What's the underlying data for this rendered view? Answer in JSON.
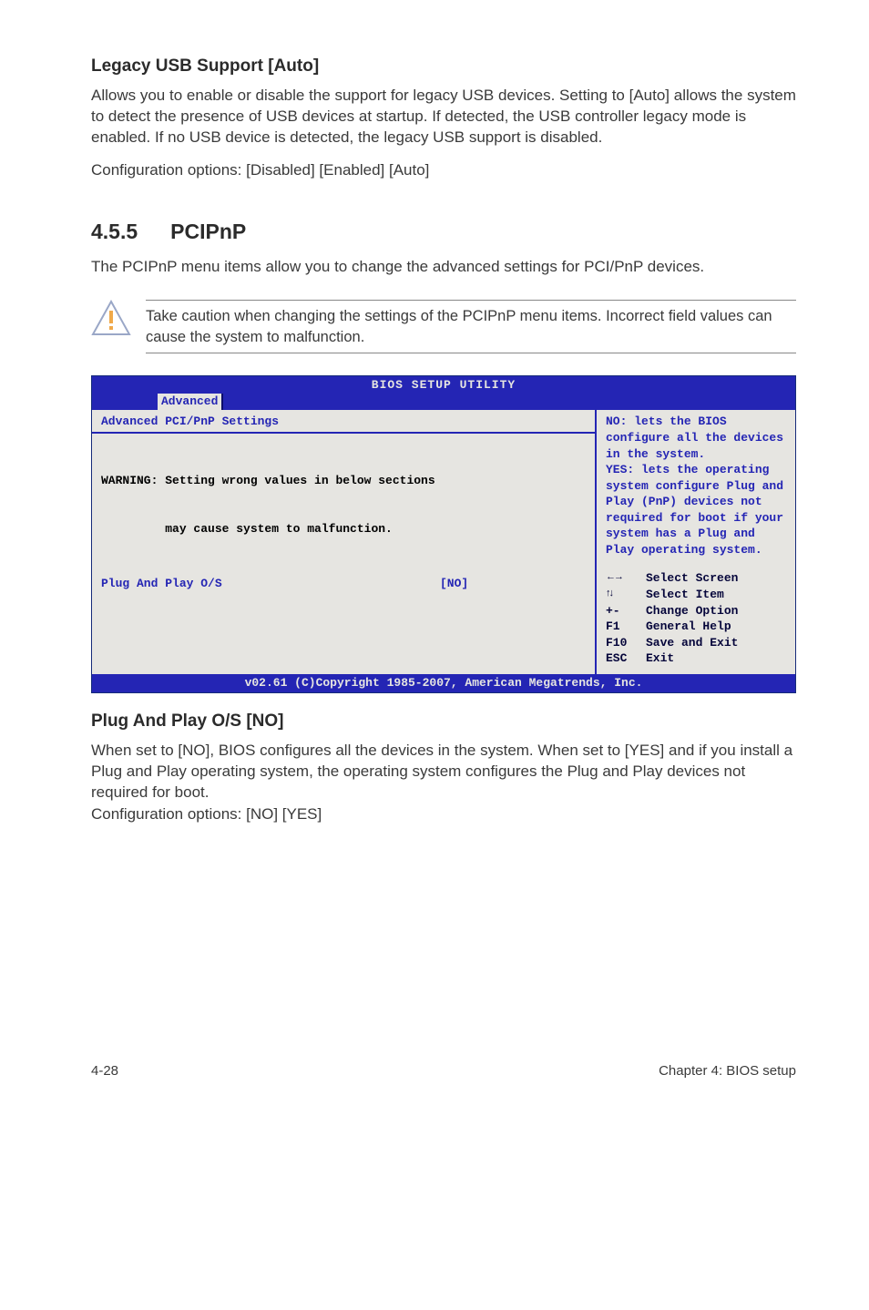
{
  "s1": {
    "heading": "Legacy USB Support [Auto]",
    "para": "Allows you to enable or disable the support for legacy USB devices. Setting to [Auto] allows the system to detect the presence of USB devices at startup. If detected, the USB controller legacy mode is enabled. If no USB device is detected, the legacy USB support is disabled.",
    "cfg": "Configuration options: [Disabled] [Enabled] [Auto]"
  },
  "sec": {
    "num": "4.5.5",
    "title": "PCIPnP",
    "intro": "The PCIPnP menu items allow you to change the advanced settings for PCI/PnP devices.",
    "note": "Take caution when changing the settings of the PCIPnP menu items. Incorrect field values can cause the system to malfunction."
  },
  "bios": {
    "title": "BIOS SETUP UTILITY",
    "tab": "Advanced",
    "panel_title": "Advanced PCI/PnP Settings",
    "warn1": "WARNING: Setting wrong values in below sections",
    "warn2": "         may cause system to malfunction.",
    "opt_label": "Plug And Play O/S",
    "opt_value": "[NO]",
    "help": "NO: lets the BIOS configure all the devices in the system.\nYES: lets the operating system configure Plug and Play (PnP) devices not required for boot if your system has a Plug and Play operating system.",
    "keys": {
      "k1": {
        "k": "←→",
        "d": "Select Screen"
      },
      "k2": {
        "k": "↑↓",
        "d": "Select Item"
      },
      "k3": {
        "k": "+-",
        "d": "Change Option"
      },
      "k4": {
        "k": "F1",
        "d": "General Help"
      },
      "k5": {
        "k": "F10",
        "d": "Save and Exit"
      },
      "k6": {
        "k": "ESC",
        "d": "Exit"
      }
    },
    "footer": "v02.61 (C)Copyright 1985-2007, American Megatrends, Inc."
  },
  "s2": {
    "heading": "Plug And Play O/S [NO]",
    "para": "When set to [NO], BIOS configures all the devices in the system. When set to [YES] and if you install a Plug and Play operating system, the operating system configures the Plug and Play devices not required for boot.",
    "cfg": "Configuration options: [NO] [YES]"
  },
  "footer": {
    "left": "4-28",
    "right": "Chapter 4: BIOS setup"
  }
}
